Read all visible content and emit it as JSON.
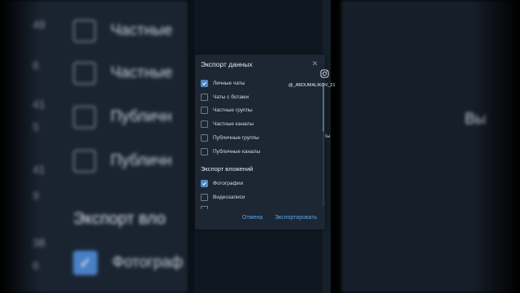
{
  "dialog": {
    "title": "Экспорт данных",
    "chats": [
      {
        "label": "Личные чаты",
        "checked": true
      },
      {
        "label": "Чаты с ботами",
        "checked": false
      },
      {
        "label": "Частные группы",
        "checked": false
      },
      {
        "label": "Частные каналы",
        "checked": false
      },
      {
        "label": "Публичные группы",
        "checked": false
      },
      {
        "label": "Публичные каналы",
        "checked": false
      }
    ],
    "attachments_title": "Экспорт вложений",
    "attachments": [
      {
        "label": "Фотографии",
        "checked": true
      },
      {
        "label": "Видеозаписи",
        "checked": false
      }
    ],
    "cancel_label": "Отмена",
    "export_label": "Экспортировать"
  },
  "watermark": {
    "handle": "@_ABDUMALIKOV_21",
    "icon": "instagram-icon"
  },
  "background": {
    "left_rows": [
      "Частные",
      "Частные",
      "Публичн",
      "Публичн"
    ],
    "left_numbers": [
      "49",
      "6",
      "41",
      "5",
      "41",
      "9",
      "38",
      "6"
    ],
    "left_heading": "Экспорт вло",
    "left_checked_label": "Фотограф",
    "right_text": "Вы",
    "phone_overlay": "Вы"
  },
  "colors": {
    "accent": "#5288c1",
    "link": "#5ea3e8",
    "dialog_bg": "#1c2733"
  }
}
